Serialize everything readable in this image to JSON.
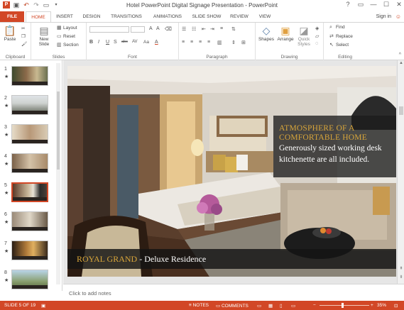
{
  "window": {
    "title": "Hotel PowerPoint Digital Signage Presentation - PowerPoint",
    "controls": [
      "?",
      "▭",
      "—",
      "☐",
      "✕"
    ]
  },
  "tabs": [
    {
      "label": "FILE"
    },
    {
      "label": "HOME"
    },
    {
      "label": "INSERT"
    },
    {
      "label": "DESIGN"
    },
    {
      "label": "TRANSITIONS"
    },
    {
      "label": "ANIMATIONS"
    },
    {
      "label": "SLIDE SHOW"
    },
    {
      "label": "REVIEW"
    },
    {
      "label": "VIEW"
    }
  ],
  "account": {
    "sign_in": "Sign in"
  },
  "ribbon": {
    "clipboard": {
      "label": "Clipboard",
      "paste": "Paste"
    },
    "slides": {
      "label": "Slides",
      "new_slide": "New Slide",
      "layout": "Layout",
      "reset": "Reset",
      "section": "Section"
    },
    "font": {
      "label": "Font",
      "buttons": [
        "B",
        "I",
        "U",
        "S",
        "abc",
        "AV",
        "Aa",
        "A"
      ]
    },
    "paragraph": {
      "label": "Paragraph"
    },
    "drawing": {
      "label": "Drawing",
      "shapes": "Shapes",
      "arrange": "Arrange",
      "quick_styles": "Quick Styles"
    },
    "editing": {
      "label": "Editing",
      "find": "Find",
      "replace": "Replace",
      "select": "Select"
    }
  },
  "thumbnails": [
    {
      "num": "1",
      "star": "★"
    },
    {
      "num": "2",
      "star": "★"
    },
    {
      "num": "3",
      "star": "★"
    },
    {
      "num": "4",
      "star": "★"
    },
    {
      "num": "5",
      "star": "★"
    },
    {
      "num": "6",
      "star": "★"
    },
    {
      "num": "7",
      "star": "★"
    },
    {
      "num": "8",
      "star": "★"
    }
  ],
  "slide": {
    "heading_line1": "ATMOSPHERE OF A",
    "heading_line2": "COMFORTABLE HOME",
    "body_line1": "Generously sized working desk",
    "body_line2": "kitchenette are all included.",
    "brand": "ROYAL GRAND",
    "brand_rest": " - Deluxe Residence"
  },
  "notes": {
    "placeholder": "Click to add notes"
  },
  "status": {
    "slide_of": "SLIDE 5 OF 19",
    "notes": "NOTES",
    "comments": "COMMENTS",
    "zoom": "35%",
    "zoom_level": 0.35
  },
  "colors": {
    "accent": "#d24726",
    "gold": "#d9a63a"
  }
}
